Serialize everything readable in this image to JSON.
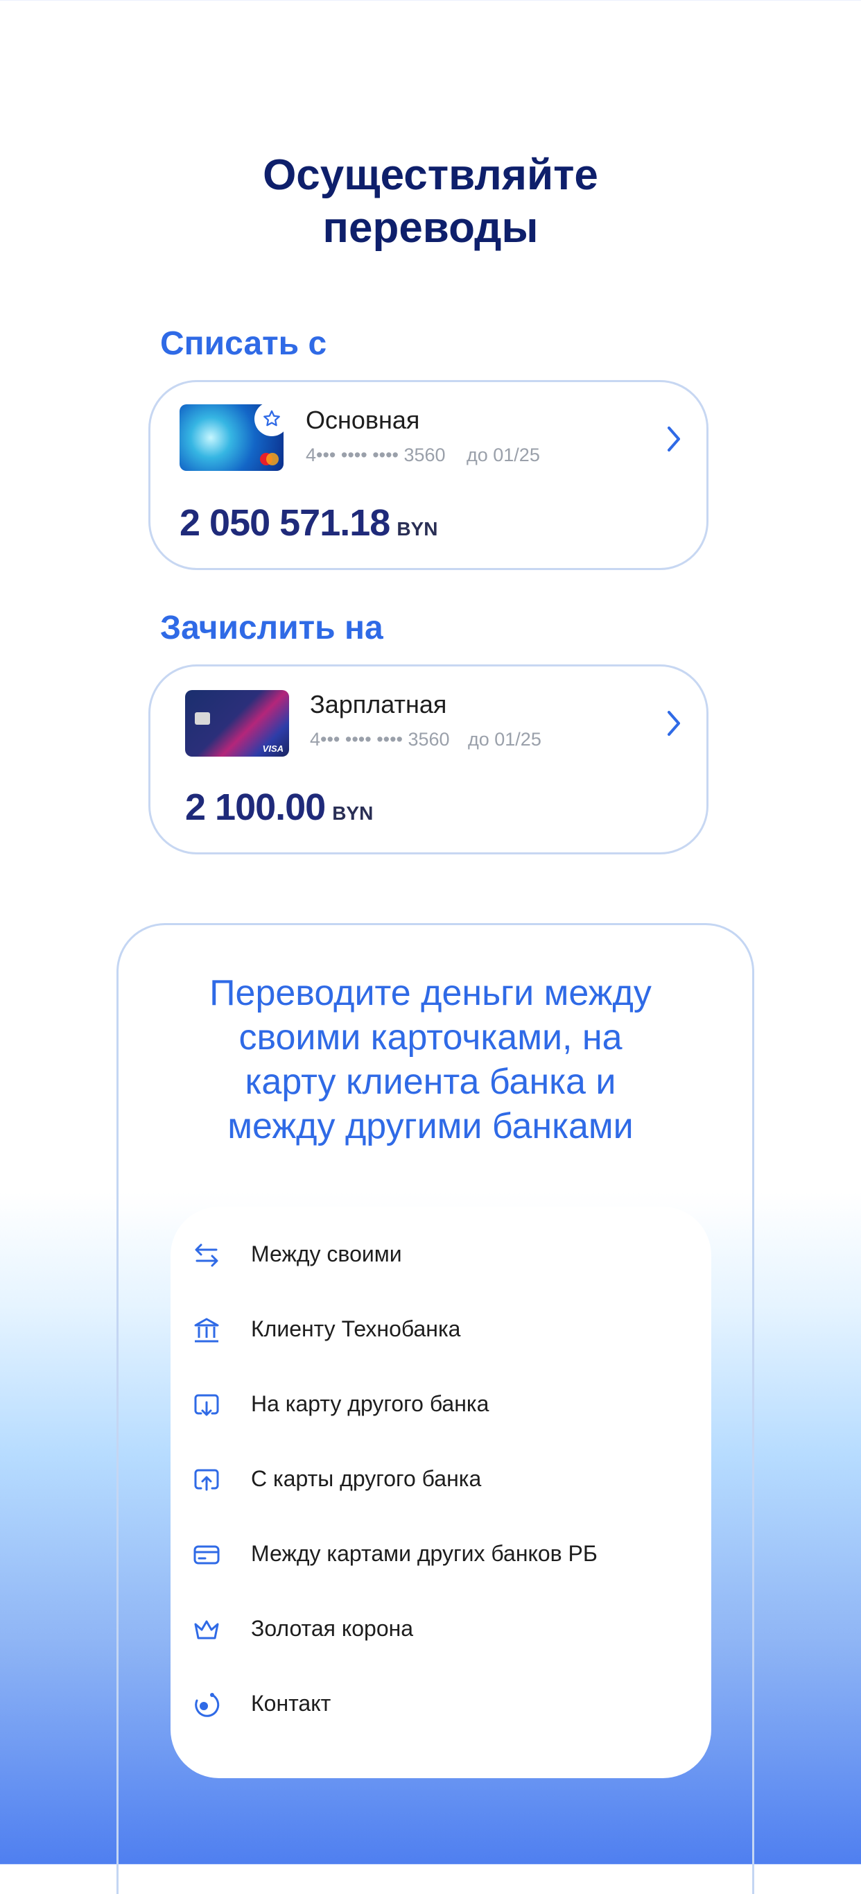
{
  "header": {
    "title_line1": "Осуществляйте",
    "title_line2": "переводы"
  },
  "from": {
    "label": "Списать с",
    "card_name": "Основная",
    "card_number": "4••• •••• •••• 3560",
    "expiry": "до 01/25",
    "amount": "2 050 571.18",
    "currency": "BYN",
    "favorite_icon": "star-icon",
    "chevron_icon": "chevron-right-icon"
  },
  "to": {
    "label": "Зачислить на",
    "card_name": "Зарплатная",
    "card_number": "4••• •••• •••• 3560",
    "expiry": "до 01/25",
    "amount": "2 100.00",
    "currency": "BYN",
    "chevron_icon": "chevron-right-icon"
  },
  "promo": {
    "line1": "Переводите деньги между",
    "line2": "своими карточками, на",
    "line3": "карту клиента банка и",
    "line4": "между другими банками"
  },
  "transfer_types": [
    {
      "label": "Между своими",
      "icon": "swap-arrows-icon"
    },
    {
      "label": "Клиенту Технобанка",
      "icon": "bank-icon"
    },
    {
      "label": "На карту другого банка",
      "icon": "card-download-icon"
    },
    {
      "label": "С карты другого банка",
      "icon": "card-upload-icon"
    },
    {
      "label": "Между картами других банков РБ",
      "icon": "card-icon"
    },
    {
      "label": "Золотая корона",
      "icon": "crown-icon"
    },
    {
      "label": "Контакт",
      "icon": "contact-logo-icon"
    }
  ],
  "colors": {
    "accent": "#2f6ae6",
    "title": "#0e1f6b",
    "amount": "#1f2a7a"
  }
}
